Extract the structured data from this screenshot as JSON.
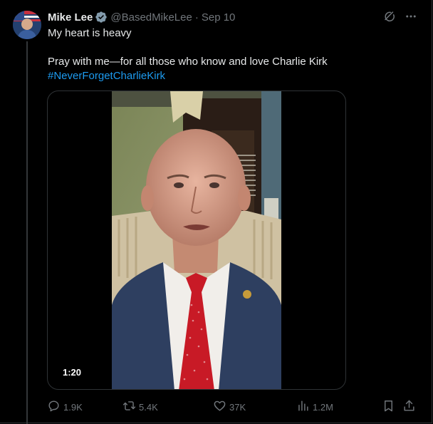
{
  "author": {
    "name": "Mike Lee",
    "handle": "@BasedMikeLee",
    "separator": "·",
    "date": "Sep 10"
  },
  "tweet": {
    "line1": "My heart is heavy",
    "line2": "Pray with me—for all those who know and love Charlie Kirk",
    "hashtag": "#NeverForgetCharlieKirk"
  },
  "media": {
    "duration": "1:20"
  },
  "actions": {
    "replies": "1.9K",
    "reposts": "5.4K",
    "likes": "37K",
    "views": "1.2M"
  },
  "icons": {
    "verified": "verified-badge-icon",
    "grok": "grok-icon",
    "more": "more-icon",
    "reply": "reply-icon",
    "repost": "repost-icon",
    "like": "like-icon",
    "views": "views-icon",
    "bookmark": "bookmark-icon",
    "share": "share-icon"
  },
  "colors": {
    "background": "#000000",
    "text": "#e7e9ea",
    "muted": "#71767b",
    "accent": "#1d9bf0",
    "border": "#2f3336"
  }
}
